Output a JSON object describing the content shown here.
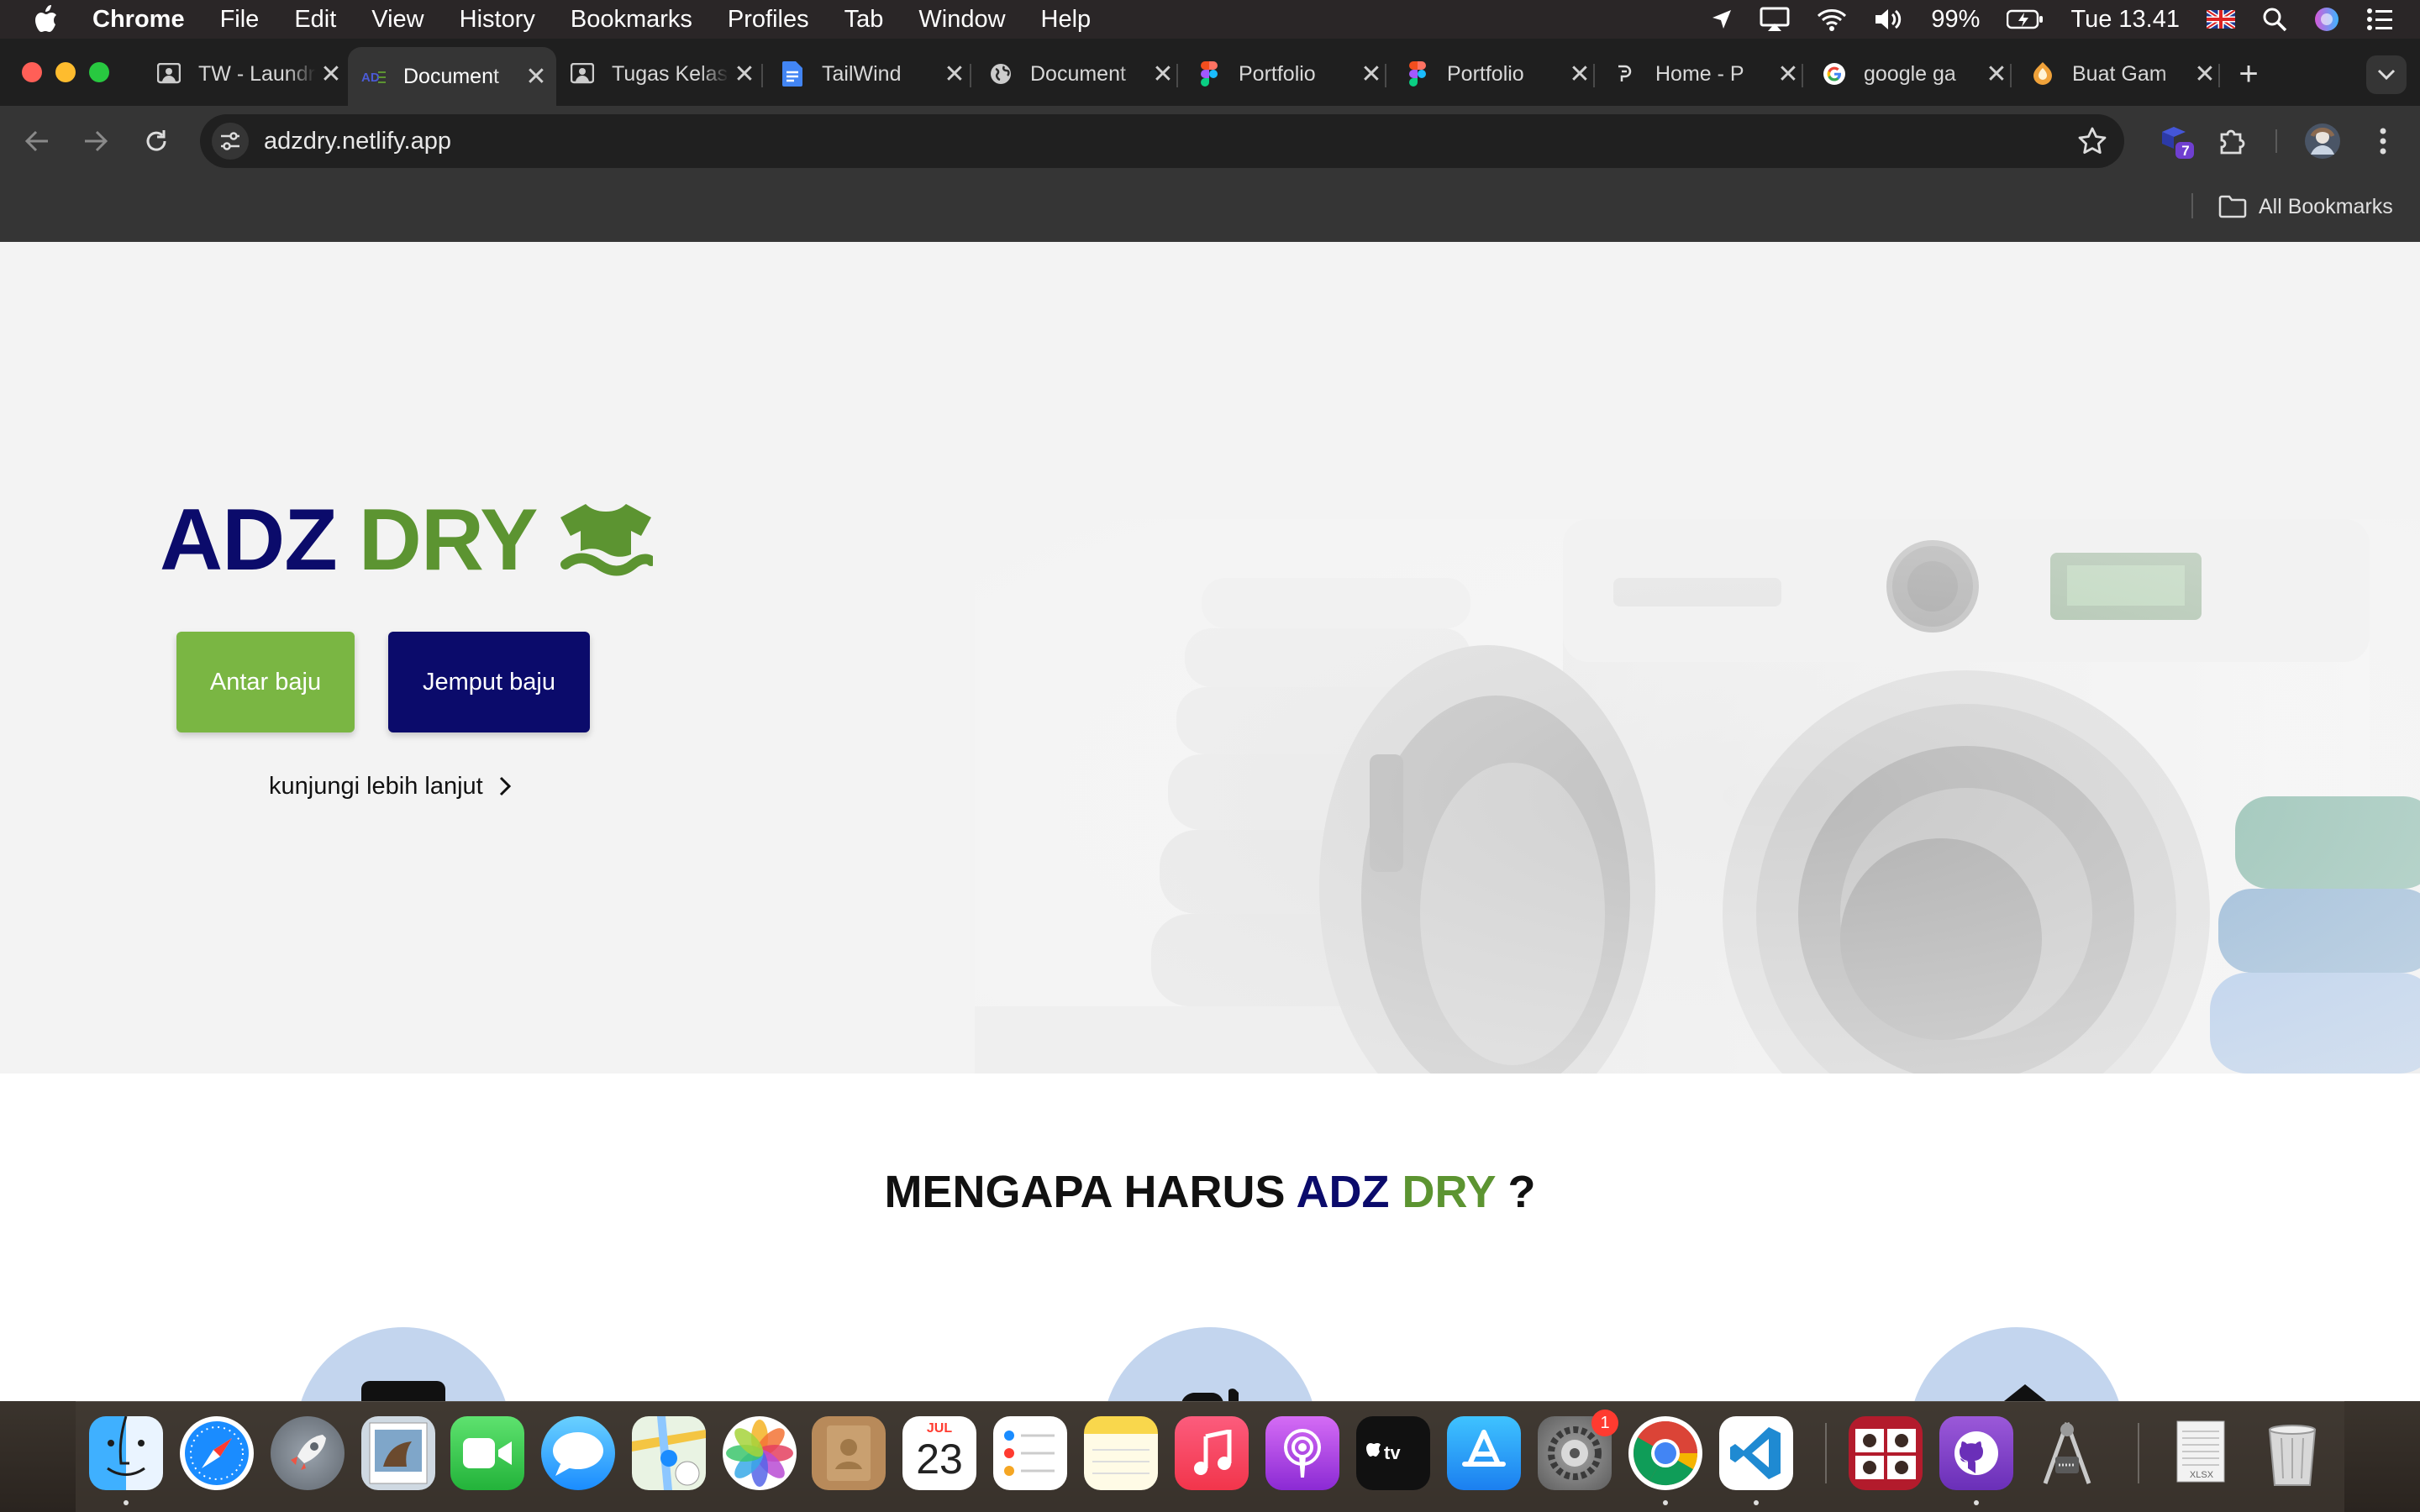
{
  "menubar": {
    "app_name": "Chrome",
    "items": [
      "File",
      "Edit",
      "View",
      "History",
      "Bookmarks",
      "Profiles",
      "Tab",
      "Window",
      "Help"
    ],
    "battery": "99%",
    "clock": "Tue 13.41"
  },
  "tabs": [
    {
      "title": "TW - Laundry",
      "icon": "classroom-icon"
    },
    {
      "title": "Document",
      "icon": "adz-logo-icon",
      "active": true
    },
    {
      "title": "Tugas Kelas",
      "icon": "classroom-icon"
    },
    {
      "title": "TailWind",
      "icon": "google-docs-icon"
    },
    {
      "title": "Document",
      "icon": "globe-icon"
    },
    {
      "title": "Portfolio",
      "icon": "figma-icon"
    },
    {
      "title": "Portfolio",
      "icon": "figma-icon"
    },
    {
      "title": "Home - P",
      "icon": "dribbble-icon"
    },
    {
      "title": "google ga",
      "icon": "google-icon"
    },
    {
      "title": "Buat Gam",
      "icon": "blogger-icon"
    }
  ],
  "toolbar": {
    "url": "adzdry.netlify.app",
    "extension_badge": "7"
  },
  "bookmarks_bar": {
    "all_bookmarks": "All Bookmarks"
  },
  "hero": {
    "brand_first": "ADZ",
    "brand_second": "DRY",
    "btn_antar": "Antar baju",
    "btn_jemput": "Jemput baju",
    "more_link": "kunjungi lebih lanjut"
  },
  "why": {
    "prefix": "MENGAPA HARUS",
    "brand_first": "ADZ",
    "brand_second": "DRY",
    "suffix": "?"
  },
  "dock": {
    "apps": [
      "Finder",
      "Safari",
      "Launchpad",
      "Preview",
      "FaceTime",
      "Messages",
      "Maps",
      "Photos",
      "Contacts",
      "Calendar",
      "Reminders",
      "Notes",
      "Music",
      "Podcasts",
      "TV",
      "App Store",
      "System Preferences",
      "Chrome",
      "VS Code",
      "Photo Booth",
      "GitHub Desktop",
      "Instruments",
      "Documents",
      "Trash"
    ],
    "calendar_month": "JUL",
    "calendar_day": "23",
    "settings_badge": "1",
    "doc_label": "XLSX"
  },
  "colors": {
    "brand_navy": "#0b0b6b",
    "brand_green": "#5c9431",
    "button_green": "#7ab643"
  }
}
